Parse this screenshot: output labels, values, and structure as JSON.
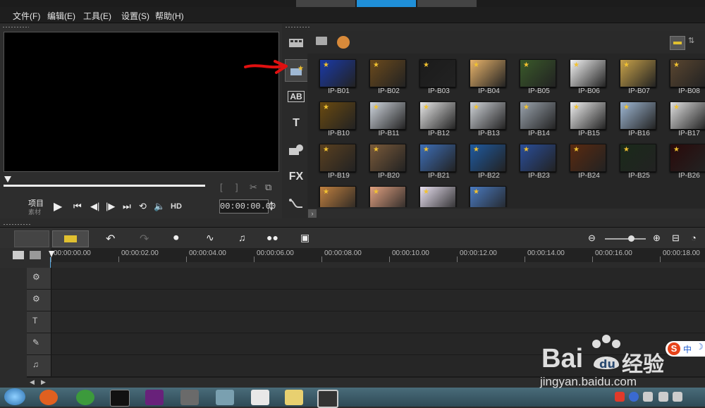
{
  "menu": [
    "文件(F)",
    "编辑(E)",
    "工具(E)",
    "设置(S)",
    "帮助(H)"
  ],
  "preview": {
    "mode_label": "项目",
    "mode_sub": "素材",
    "hd_label": "HD",
    "timecode": "00:00:00.00"
  },
  "tools": [
    {
      "icon": "media-icon"
    },
    {
      "icon": "instant-project-icon"
    },
    {
      "icon": "transition-icon",
      "label": "AB"
    },
    {
      "icon": "title-icon",
      "label": "T"
    },
    {
      "icon": "graphic-icon"
    },
    {
      "icon": "filter-icon",
      "label": "FX"
    },
    {
      "icon": "path-icon"
    }
  ],
  "library": {
    "rows": [
      [
        "IP-B01",
        "IP-B02",
        "IP-B03",
        "IP-B04",
        "IP-B05",
        "IP-B06",
        "IP-B07",
        "IP-B08"
      ],
      [
        "IP-B10",
        "IP-B11",
        "IP-B12",
        "IP-B13",
        "IP-B14",
        "IP-B15",
        "IP-B16",
        "IP-B17"
      ],
      [
        "IP-B19",
        "IP-B20",
        "IP-B21",
        "IP-B22",
        "IP-B23",
        "IP-B24",
        "IP-B25",
        "IP-B26"
      ],
      [
        "",
        "",
        "",
        ""
      ]
    ],
    "thumb_colors": [
      [
        "#1a3aa8",
        "#6b4a1c",
        "#1b1b1b",
        "#e9b46b",
        "#3a5a2a",
        "#f4f4f4",
        "#c8a24a",
        "#5a4630"
      ],
      [
        "#6a4a10",
        "#d0d6de",
        "#e8e8e8",
        "#cfd3d8",
        "#9aa3ad",
        "#f0f0f0",
        "#9fb8d4",
        "#e0e0e0"
      ],
      [
        "#5a4020",
        "#7a5a3a",
        "#3e6fb8",
        "#1f5aa0",
        "#2a4e9a",
        "#5a2a10",
        "#1a2a1a",
        "#2a0a0a"
      ],
      [
        "#c08040",
        "#e0a080",
        "#e8e0f0",
        "#4a7ac0"
      ]
    ]
  },
  "timeline": {
    "ruler": [
      "00:00:00.00",
      "00:00:02.00",
      "00:00:04.00",
      "00:00:06.00",
      "00:00:08.00",
      "00:00:10.00",
      "00:00:12.00",
      "00:00:14.00",
      "00:00:16.00",
      "00:00:18.00"
    ],
    "tracks": [
      "video-track",
      "overlay-track",
      "title-track",
      "voice-track",
      "music-track"
    ]
  },
  "watermark": {
    "brand": "Bai",
    "brand2": "经验",
    "url": "jingyan.baidu.com"
  },
  "ime": "中"
}
